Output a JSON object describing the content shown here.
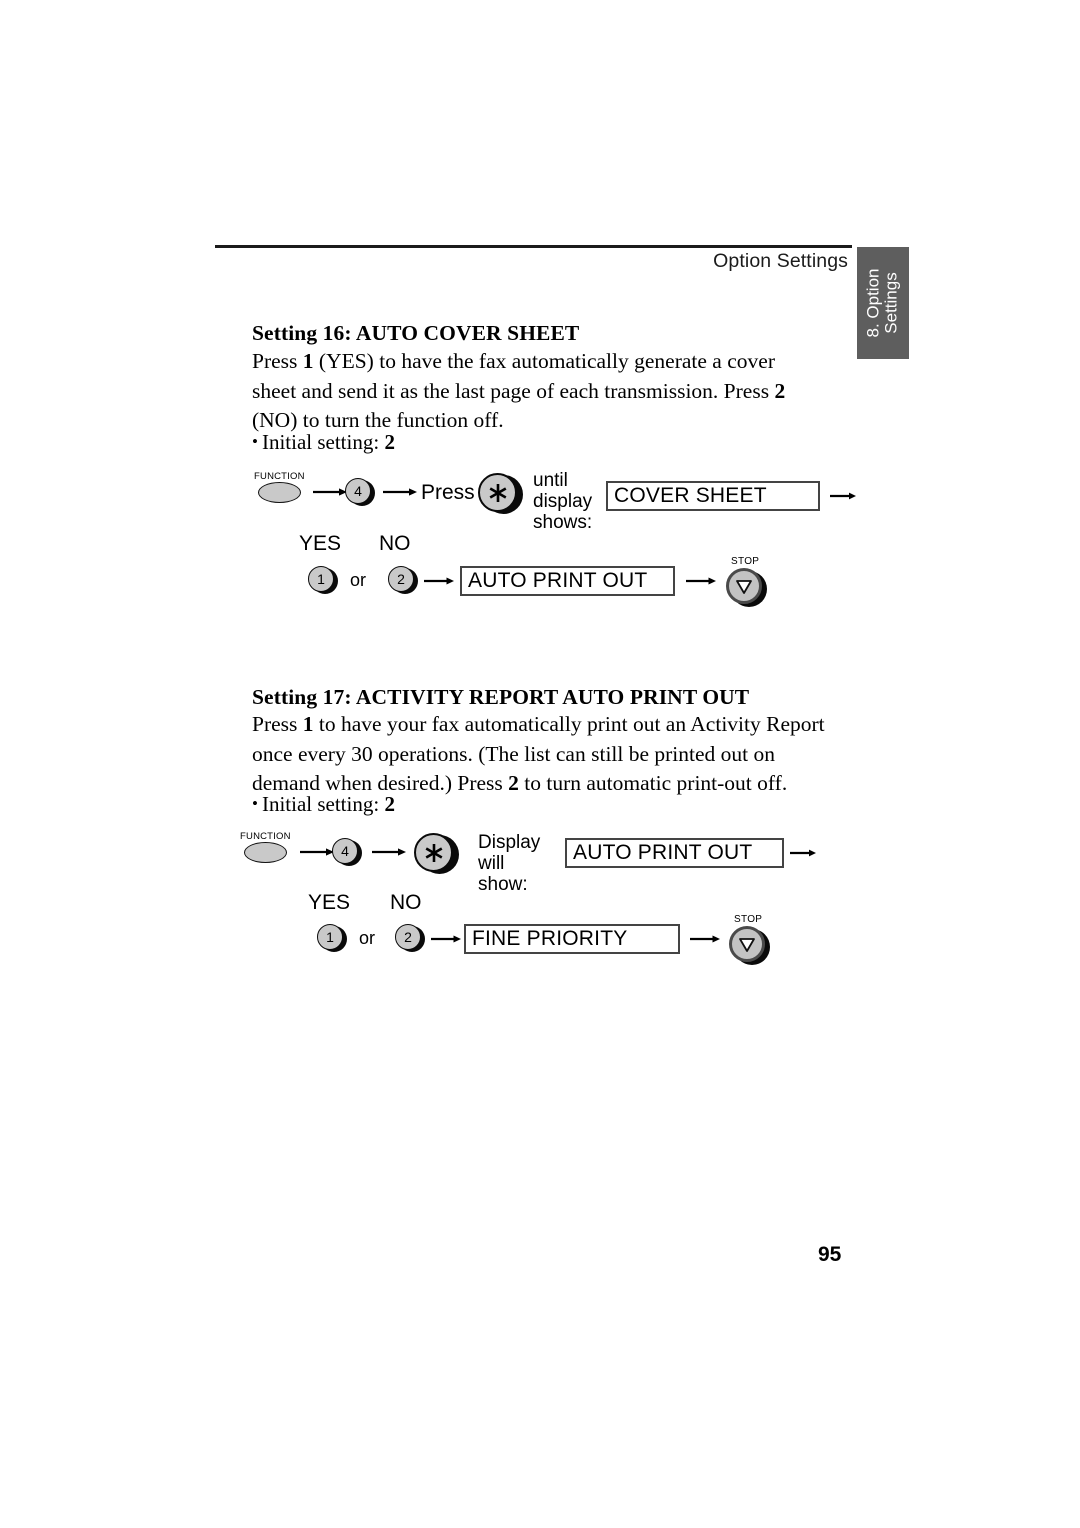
{
  "header": {
    "running_title": "Option Settings",
    "thumb_tab_line1": "8. Option",
    "thumb_tab_line2": "Settings"
  },
  "page_number": "95",
  "sections": [
    {
      "heading": "Setting 16: AUTO COVER SHEET",
      "body_parts": [
        {
          "text": "Press ",
          "bold": false
        },
        {
          "text": "1",
          "bold": true
        },
        {
          "text": " (YES) to have the fax automatically generate a cover sheet and send it as the last page of each transmission. Press ",
          "bold": false
        },
        {
          "text": "2",
          "bold": true
        },
        {
          "text": " (NO) to turn the function off.",
          "bold": false
        }
      ],
      "initial_setting_label": "Initial setting:",
      "initial_setting_value": "2",
      "diagram": {
        "function_key_label": "FUNCTION",
        "number_key": "4",
        "press_label": "Press",
        "star_key": "star-key",
        "annotation_lines": [
          "until",
          "display",
          "shows:"
        ],
        "display_top": "COVER SHEET",
        "yes_label": "YES",
        "no_label": "NO",
        "yes_key": "1",
        "or_label": "or",
        "no_key": "2",
        "display_bottom": "AUTO PRINT OUT",
        "stop_label": "STOP"
      }
    },
    {
      "heading": "Setting 17: ACTIVITY REPORT AUTO PRINT OUT",
      "body_parts": [
        {
          "text": "Press ",
          "bold": false
        },
        {
          "text": "1",
          "bold": true
        },
        {
          "text": " to have your fax automatically print out an Activity Report once every 30 operations. (The list can still be printed out on demand when desired.) Press ",
          "bold": false
        },
        {
          "text": "2",
          "bold": true
        },
        {
          "text": " to turn automatic print-out off.",
          "bold": false
        }
      ],
      "initial_setting_label": "Initial setting:",
      "initial_setting_value": "2",
      "diagram": {
        "function_key_label": "FUNCTION",
        "number_key": "4",
        "press_label": "",
        "star_key": "star-key",
        "annotation_lines": [
          "Display",
          "will show:"
        ],
        "display_top": "AUTO PRINT OUT",
        "yes_label": "YES",
        "no_label": "NO",
        "yes_key": "1",
        "or_label": "or",
        "no_key": "2",
        "display_bottom": "FINE PRIORITY",
        "stop_label": "STOP"
      }
    }
  ],
  "colors": {
    "tab_background": "#5e5e5e",
    "key_face": "#c9c9c9",
    "key_outline": "#0a0a0a",
    "rule": "#1b1b1b"
  }
}
